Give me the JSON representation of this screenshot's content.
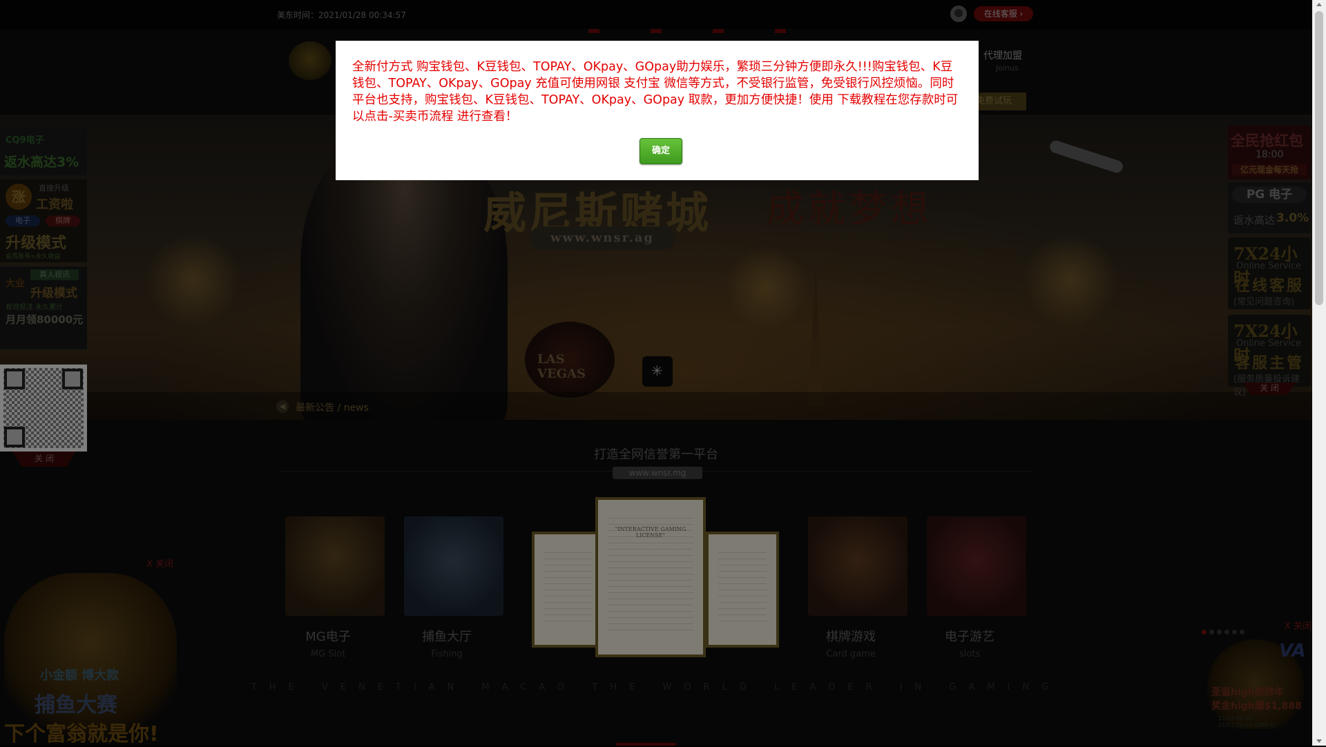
{
  "topbar": {
    "time_text": "美东时间：2021/01/28 00:34:57",
    "customer_service": "在线客服 ›"
  },
  "header": {
    "agent": "代理加盟",
    "agent_en": "Joinus",
    "trial": "免费试玩"
  },
  "hero": {
    "title": "威尼斯赌城",
    "slogan": "成就梦想",
    "url": "www.wnsr.ag",
    "sign": "LAS VEGAS",
    "news_label": "最新公告 / news",
    "loading_glyph": "✳"
  },
  "main": {
    "heading": "打造全网信誉第一平台",
    "domain": "www.wnsr.mg",
    "cards": [
      {
        "title": "MG电子",
        "sub": "MG Slot"
      },
      {
        "title": "捕鱼大厅",
        "sub": "Fishing"
      },
      {
        "title": "棋牌游戏",
        "sub": "Card game"
      },
      {
        "title": "电子游艺",
        "sub": "slots"
      }
    ],
    "certificate_title": "\"INTERACTIVE GAMING LICENSE\"",
    "tagline": "THE VENETIAN MACAO THE WORLD LEADER IN GAMING"
  },
  "left_side": {
    "cqq_logo": "CQ9电子",
    "cqq_rebate": "返水高达3%",
    "grow_big": "涨",
    "grow_top": "直接升级",
    "grow_salary": "工资啦",
    "tag_dianzi": "电子",
    "tag_qipai": "棋牌",
    "upgrade_mode": "升级模式",
    "member_note": "会员账号=永久收益",
    "live_tag": "真人视讯",
    "live_left": "大业",
    "live_mode": "升级模式",
    "live_note": "有效投注 永久累计",
    "monthly": "月月领80000元",
    "close": "关 闭"
  },
  "right_side": {
    "hongbao_title": "全民抢红包",
    "hongbao_time": "18:00",
    "hongbao_sub": "亿元现金每天抢",
    "pg_logo": "PG 电子",
    "pg_rebate_label": "返水高达",
    "pg_rebate_value": "3.0%",
    "cs1_big": "7X24小时",
    "cs1_en": "Online Service",
    "cs1_name": "在线客服",
    "cs1_note": "(常见问题咨询)",
    "cs2_big": "7X24小时",
    "cs2_en": "Online Service",
    "cs2_name": "客服主管",
    "cs2_note": "(服务质量投诉建议)",
    "close": "关 闭"
  },
  "float_left": {
    "close": "X 关闭",
    "line1": "小金额 博大款",
    "line2": "捕鱼大赛",
    "line3": "下个富翁就是你!"
  },
  "float_right": {
    "close": "X 关闭",
    "line1": "圣诞high到跨年",
    "line2": "奖金high爆$1,888",
    "date1": "12/23 00:00 -",
    "date2": "01/07 23:59 (GMT-4)",
    "brand": "VA",
    "active_dot": 0,
    "dot_count": 6
  },
  "modal": {
    "message": "全新付方式 购宝钱包、K豆钱包、TOPAY、OKpay、GOpay助力娱乐，繁琐三分钟方便即永久!!!购宝钱包、K豆钱包、TOPAY、OKpay、GOpay 充值可使用网银 支付宝 微信等方式，不受银行监管，免受银行风控烦恼。同时平台也支持，购宝钱包、K豆钱包、TOPAY、OKpay、GOpay 取款，更加方便快捷！使用 下载教程在您存款时可以点击-买卖币流程 进行查看！",
    "confirm": "确定"
  },
  "colors": {
    "modal_text": "#e40000",
    "confirm_button": "#4cae2a",
    "page_bg": "#000000"
  }
}
